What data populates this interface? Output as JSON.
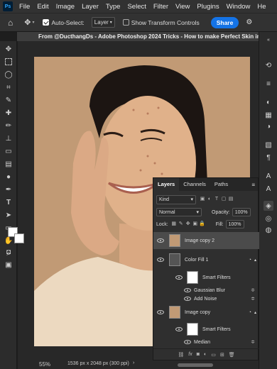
{
  "menu": {
    "app_icon": "Ps",
    "items": [
      "File",
      "Edit",
      "Image",
      "Layer",
      "Type",
      "Select",
      "Filter",
      "View",
      "Plugins",
      "Window",
      "He"
    ]
  },
  "options": {
    "auto_select_label": "Auto-Select:",
    "auto_select_value": "Layer",
    "transform_label": "Show Transform Controls",
    "share_label": "Share"
  },
  "document": {
    "tab_title": "From @DucthangDs - Adobe Photoshop 2024 Tricks - How to make Perfect Skin in Mir"
  },
  "status": {
    "zoom": "55%",
    "info": "1536 px x 2048 px (300 ppi)"
  },
  "layers_panel": {
    "tabs": [
      "Layers",
      "Channels",
      "Paths"
    ],
    "kind_label": "Kind",
    "blend_mode": "Normal",
    "opacity_label": "Opacity:",
    "opacity_value": "100%",
    "lock_label": "Lock:",
    "fill_label": "Fill:",
    "fill_value": "100%",
    "layers": [
      {
        "name": "Image copy 2"
      },
      {
        "name": "Color Fill 1"
      },
      {
        "name": "Smart Filters"
      },
      {
        "name": "Gaussian Blur"
      },
      {
        "name": "Add Noise"
      },
      {
        "name": "Image copy"
      },
      {
        "name": "Smart Filters"
      },
      {
        "name": "Median"
      }
    ],
    "footer_fx": "fx"
  },
  "colors": {
    "accent": "#1473e6",
    "background": "#c19a75"
  }
}
